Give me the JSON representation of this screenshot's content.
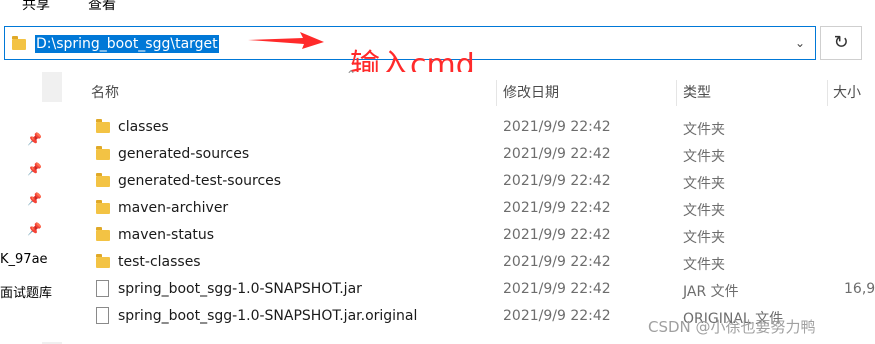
{
  "ribbon": {
    "tabs": [
      "共享",
      "查看"
    ]
  },
  "address_bar": {
    "path": "D:\\spring_boot_sgg\\target",
    "dropdown_icon": "chevron-down-icon",
    "refresh_icon": "refresh-icon"
  },
  "annotation": {
    "text": "输入cmd",
    "color": "#ff2a2a"
  },
  "nav_pane": {
    "text_1": "K_97ae",
    "text_2": "面试题库"
  },
  "columns": {
    "name": "名称",
    "date": "修改日期",
    "type": "类型",
    "size": "大小"
  },
  "files": [
    {
      "name": "classes",
      "date": "2021/9/9 22:42",
      "type": "文件夹",
      "size": "",
      "icon": "folder-icon"
    },
    {
      "name": "generated-sources",
      "date": "2021/9/9 22:42",
      "type": "文件夹",
      "size": "",
      "icon": "folder-icon"
    },
    {
      "name": "generated-test-sources",
      "date": "2021/9/9 22:42",
      "type": "文件夹",
      "size": "",
      "icon": "folder-icon"
    },
    {
      "name": "maven-archiver",
      "date": "2021/9/9 22:42",
      "type": "文件夹",
      "size": "",
      "icon": "folder-icon"
    },
    {
      "name": "maven-status",
      "date": "2021/9/9 22:42",
      "type": "文件夹",
      "size": "",
      "icon": "folder-icon"
    },
    {
      "name": "test-classes",
      "date": "2021/9/9 22:42",
      "type": "文件夹",
      "size": "",
      "icon": "folder-icon"
    },
    {
      "name": "spring_boot_sgg-1.0-SNAPSHOT.jar",
      "date": "2021/9/9 22:42",
      "type": "JAR 文件",
      "size": "16,9",
      "icon": "file-icon"
    },
    {
      "name": "spring_boot_sgg-1.0-SNAPSHOT.jar.original",
      "date": "2021/9/9 22:42",
      "type": "ORIGINAL 文件",
      "size": "",
      "icon": "file-icon"
    }
  ],
  "watermark": "CSDN @小徐也要努力鸭",
  "colors": {
    "accent": "#0078d7",
    "folder": "#f3c344"
  }
}
